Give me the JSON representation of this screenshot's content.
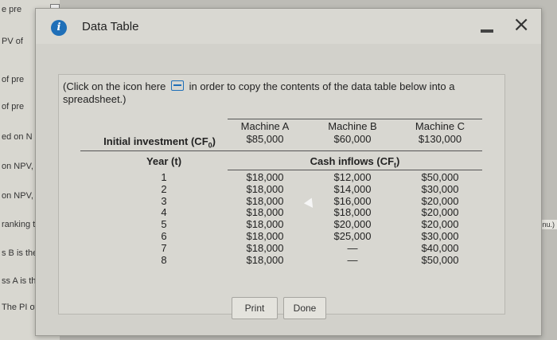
{
  "background": {
    "fragments": [
      "e pre",
      "PV of",
      "of pre",
      "of pre",
      "ed on N",
      "on NPV,",
      "on NPV,",
      "ranking t",
      "s B  is the",
      "ss A  is the",
      "The PI of pre"
    ],
    "right_fragment": "own menu.)"
  },
  "dialog": {
    "title": "Data Table",
    "info_icon": "i",
    "close_glyph": "×",
    "note_pre": "(Click on the icon here",
    "note_post": "in order to copy the contents of the data table below into a spreadsheet.)"
  },
  "table": {
    "initial_investment_label": "Initial investment (CF",
    "initial_investment_sub": "0",
    "year_label": "Year (t)",
    "cash_inflows_label": "Cash inflows (CF",
    "cash_inflows_sub": "t",
    "machines": [
      {
        "name": "Machine A",
        "investment": "$85,000"
      },
      {
        "name": "Machine B",
        "investment": "$60,000"
      },
      {
        "name": "Machine C",
        "investment": "$130,000"
      }
    ],
    "years": [
      "1",
      "2",
      "3",
      "4",
      "5",
      "6",
      "7",
      "8"
    ],
    "inflows": {
      "A": [
        "$18,000",
        "$18,000",
        "$18,000",
        "$18,000",
        "$18,000",
        "$18,000",
        "$18,000",
        "$18,000"
      ],
      "B": [
        "$12,000",
        "$14,000",
        "$16,000",
        "$18,000",
        "$20,000",
        "$25,000",
        "—",
        "—"
      ],
      "C": [
        "$50,000",
        "$30,000",
        "$20,000",
        "$20,000",
        "$20,000",
        "$30,000",
        "$40,000",
        "$50,000"
      ]
    }
  },
  "buttons": {
    "print": "Print",
    "done": "Done"
  }
}
